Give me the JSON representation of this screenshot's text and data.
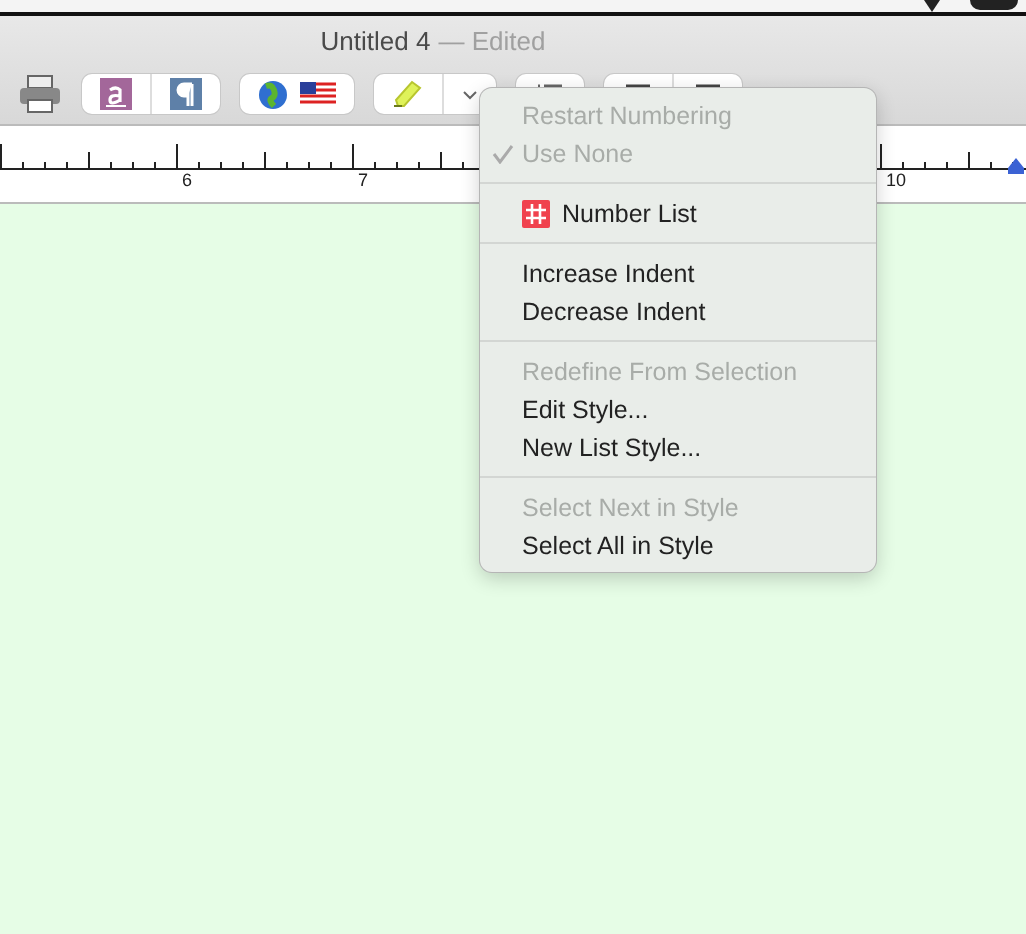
{
  "window": {
    "title": "Untitled 4",
    "status": "— Edited"
  },
  "ruler": {
    "labels": [
      {
        "text": "6"
      },
      {
        "text": "7"
      },
      {
        "text": "10"
      }
    ]
  },
  "menu": {
    "sections": [
      {
        "items": [
          {
            "label": "Restart Numbering",
            "disabled": true,
            "checked": false
          },
          {
            "label": "Use None",
            "disabled": true,
            "checked": true
          }
        ]
      },
      {
        "items": [
          {
            "label": "Number List",
            "disabled": false,
            "checked": false,
            "kind": "icon"
          }
        ]
      },
      {
        "items": [
          {
            "label": "Increase Indent",
            "disabled": false,
            "checked": false
          },
          {
            "label": "Decrease Indent",
            "disabled": false,
            "checked": false
          }
        ]
      },
      {
        "items": [
          {
            "label": "Redefine From Selection",
            "disabled": true,
            "checked": false
          },
          {
            "label": "Edit Style...",
            "disabled": false,
            "checked": false
          },
          {
            "label": "New List Style...",
            "disabled": false,
            "checked": false
          }
        ]
      },
      {
        "items": [
          {
            "label": "Select Next in Style",
            "disabled": true,
            "checked": false
          },
          {
            "label": "Select All in Style",
            "disabled": false,
            "checked": false
          }
        ]
      }
    ]
  }
}
